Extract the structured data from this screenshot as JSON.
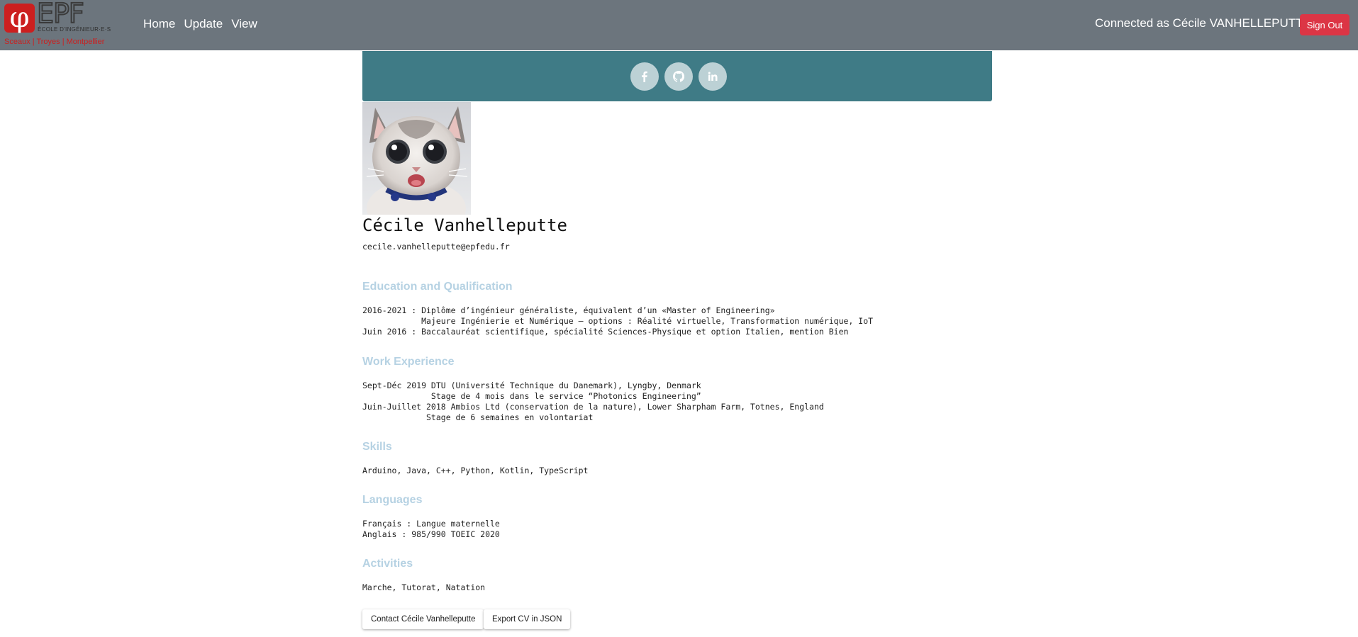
{
  "navbar": {
    "logo": {
      "symbol": "φ",
      "brand": "EPF",
      "tagline": "ÉCOLE D'INGÉNIEUR·E·S",
      "cities": "Sceaux | Troyes | Montpellier"
    },
    "links": [
      "Home",
      "Update",
      "View"
    ],
    "connected_text": "Connected as Cécile VANHELLEPUTTE",
    "signout_label": "Sign Out"
  },
  "social": {
    "icons": [
      "facebook-icon",
      "github-icon",
      "linkedin-icon"
    ],
    "bar_color": "#3f7b86"
  },
  "profile": {
    "name": "Cécile Vanhelleputte",
    "email": "cecile.vanhelleputte@epfedu.fr",
    "avatar": "cat-photo"
  },
  "sections": {
    "education": {
      "title": "Education and Qualification",
      "body": "2016-2021 : Diplôme d’ingénieur généraliste, équivalent d’un «Master of Engineering»\n            Majeure Ingénierie et Numérique – options : Réalité virtuelle, Transformation numérique, IoT\nJuin 2016 : Baccalauréat scientifique, spécialité Sciences-Physique et option Italien, mention Bien"
    },
    "work": {
      "title": "Work Experience",
      "body": "Sept-Déc 2019 DTU (Université Technique du Danemark), Lyngby, Denmark\n              Stage de 4 mois dans le service “Photonics Engineering”\nJuin-Juillet 2018 Ambios Ltd (conservation de la nature), Lower Sharpham Farm, Totnes, England\n             Stage de 6 semaines en volontariat"
    },
    "skills": {
      "title": "Skills",
      "body": "Arduino, Java, C++, Python, Kotlin, TypeScript"
    },
    "languages": {
      "title": "Languages",
      "body": "Français : Langue maternelle\nAnglais : 985/990 TOEIC 2020"
    },
    "activities": {
      "title": "Activities",
      "body": "Marche, Tutorat, Natation"
    }
  },
  "actions": {
    "contact_label": "Contact Cécile Vanhelleputte",
    "export_label": "Export CV in JSON"
  },
  "colors": {
    "navbar": "#6c757d",
    "signout": "#dc3545",
    "section_title": "#b6d2e3"
  }
}
